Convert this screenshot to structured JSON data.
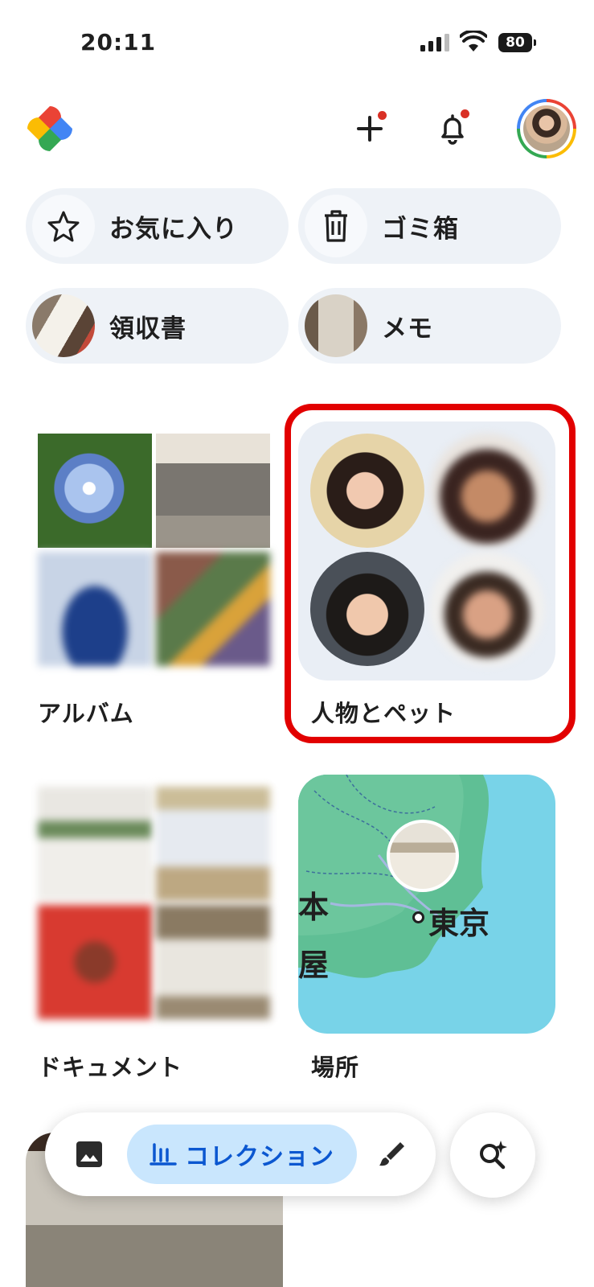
{
  "status_bar": {
    "time": "20:11",
    "battery": "80"
  },
  "header": {
    "add_icon": "plus-icon",
    "notification_icon": "bell-icon"
  },
  "chips": [
    {
      "label": "お気に入り",
      "icon": "star-icon"
    },
    {
      "label": "ゴミ箱",
      "icon": "trash-icon"
    },
    {
      "label": "領収書",
      "icon": "receipt-thumbnail"
    },
    {
      "label": "メモ",
      "icon": "memo-thumbnail"
    }
  ],
  "collections": {
    "albums": {
      "title": "アルバム"
    },
    "people": {
      "title": "人物とペット"
    },
    "documents": {
      "title": "ドキュメント"
    },
    "places": {
      "title": "場所",
      "map_labels": [
        "本",
        "東京",
        "屋"
      ]
    }
  },
  "bottom_nav": {
    "photos_icon": "image-icon",
    "collections_label": "コレクション",
    "collections_icon": "library-icon",
    "create_icon": "brush-icon",
    "search_icon": "search-sparkle-icon"
  },
  "colors": {
    "accent": "#0b57d0",
    "pill": "#c9e6fd",
    "highlight": "#e20000",
    "chip_bg": "#eef2f7"
  }
}
